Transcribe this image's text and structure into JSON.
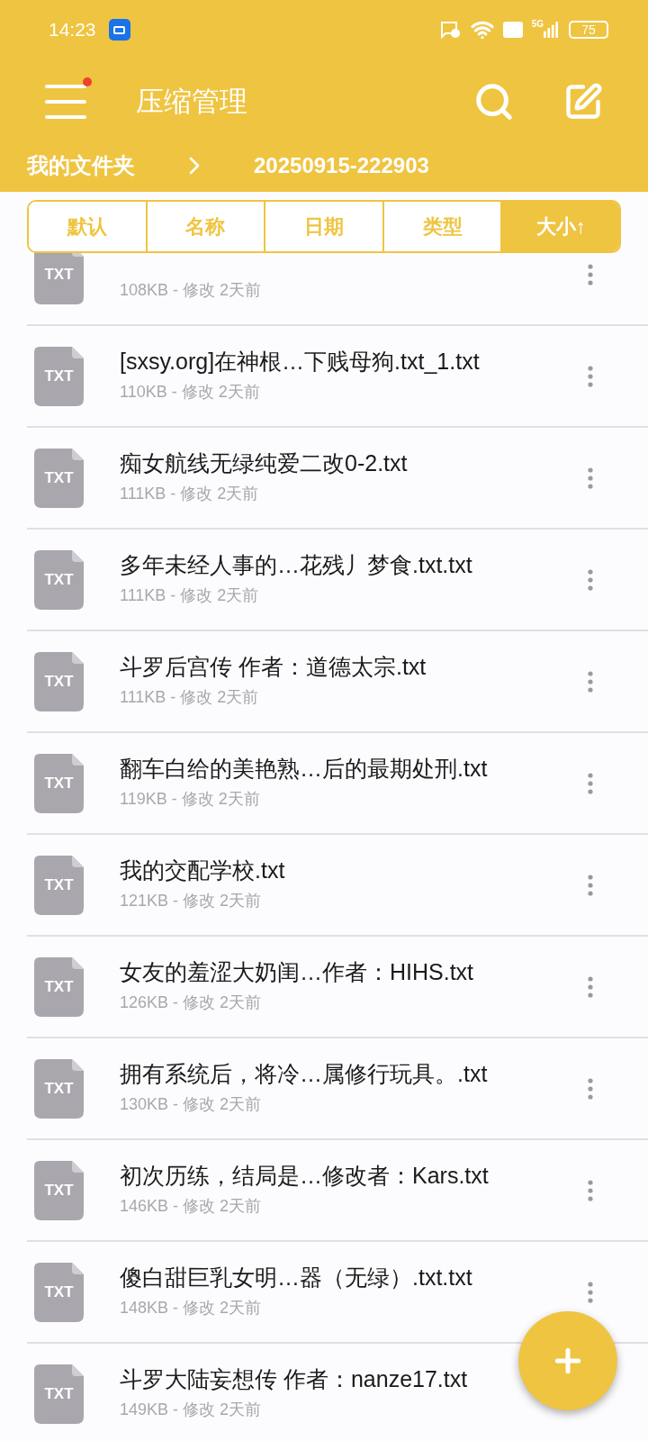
{
  "status_bar": {
    "time": "14:23",
    "battery": "75",
    "network": "5G"
  },
  "header": {
    "title": "压缩管理",
    "menu_badge": true
  },
  "breadcrumb": [
    "我的文件夹",
    "20250915-222903"
  ],
  "sort_tabs": [
    {
      "label": "默认",
      "selected": false
    },
    {
      "label": "名称",
      "selected": false
    },
    {
      "label": "日期",
      "selected": false
    },
    {
      "label": "类型",
      "selected": false
    },
    {
      "label": "大小↑",
      "selected": true
    }
  ],
  "files": [
    {
      "type": "TXT",
      "meta": "108KB - 修改 2天前",
      "menu": true
    },
    {
      "type": "TXT",
      "name": "[sxsy.org]在神根…下贱母狗.txt_1.txt",
      "meta": "110KB - 修改 2天前",
      "menu": true
    },
    {
      "type": "TXT",
      "name": "痴女航线无绿纯爱二改0-2.txt",
      "meta": "111KB - 修改 2天前",
      "menu": true
    },
    {
      "type": "TXT",
      "name": "多年未经人事的…花残丿梦食.txt.txt",
      "meta": "111KB - 修改 2天前",
      "menu": true
    },
    {
      "type": "TXT",
      "name": "斗罗后宫传 作者：道德太宗.txt",
      "meta": "111KB - 修改 2天前",
      "menu": true
    },
    {
      "type": "TXT",
      "name": "翻车白给的美艳熟…后的最期处刑.txt",
      "meta": "119KB - 修改 2天前",
      "menu": true
    },
    {
      "type": "TXT",
      "name": "我的交配学校.txt",
      "meta": "121KB - 修改 2天前",
      "menu": true
    },
    {
      "type": "TXT",
      "name": "女友的羞涩大奶闺…作者：HIHS.txt",
      "meta": "126KB - 修改 2天前",
      "menu": true
    },
    {
      "type": "TXT",
      "name": "拥有系统后，将冷…属修行玩具。.txt",
      "meta": "130KB - 修改 2天前",
      "menu": true
    },
    {
      "type": "TXT",
      "name": "初次历练，结局是…修改者：Kars.txt",
      "meta": "146KB - 修改 2天前",
      "menu": true
    },
    {
      "type": "TXT",
      "name": "傻白甜巨乳女明…器（无绿）.txt.txt",
      "meta": "148KB - 修改 2天前",
      "menu": true
    },
    {
      "type": "TXT",
      "name": "斗罗大陆妄想传 作者：nanze17.txt",
      "meta": "149KB - 修改 2天前",
      "menu": false
    }
  ]
}
